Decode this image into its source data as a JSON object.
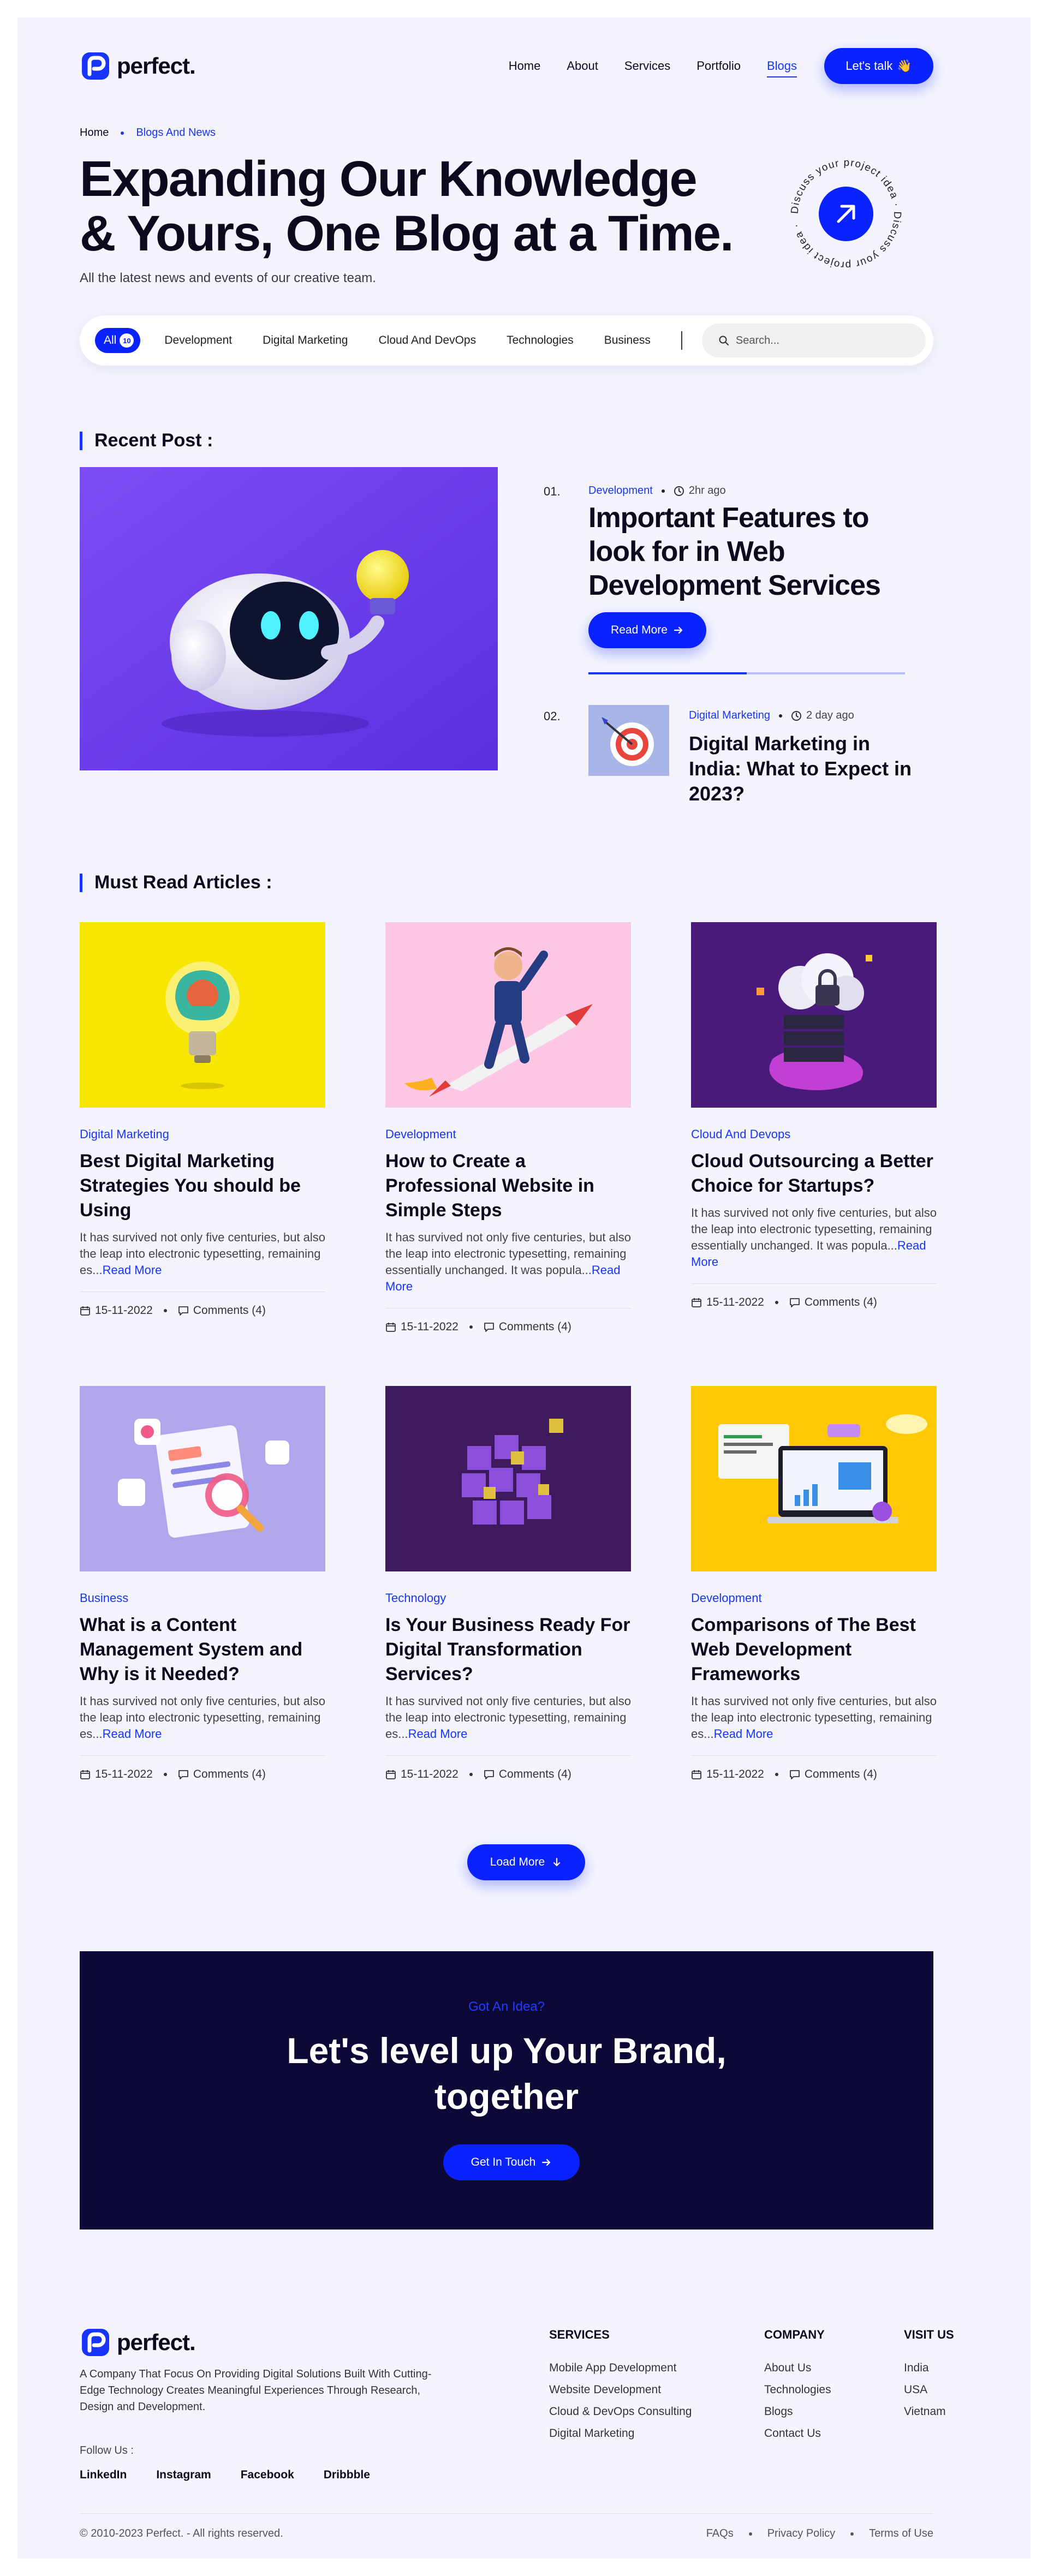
{
  "header": {
    "logo_text": "perfect.",
    "nav": [
      "Home",
      "About",
      "Services",
      "Portfolio",
      "Blogs"
    ],
    "active_nav": "Blogs",
    "cta_label": "Let's talk",
    "cta_emoji": "👋"
  },
  "breadcrumb": {
    "home": "Home",
    "current": "Blogs And News"
  },
  "hero": {
    "title": "Expanding Our Knowledge & Yours, One Blog at a Time.",
    "subtitle": "All the latest news and events of our creative team.",
    "badge_text": "Discuss your project idea · Discuss your project idea ·"
  },
  "filter": {
    "all_label": "All",
    "all_count": "10",
    "categories": [
      "Development",
      "Digital Marketing",
      "Cloud And DevOps",
      "Technologies",
      "Business"
    ],
    "search_placeholder": "Search..."
  },
  "recent": {
    "section_title": "Recent Post :",
    "post1": {
      "num": "01.",
      "category": "Development",
      "time": "2hr ago",
      "title": "Important Features to look for in Web Development Services",
      "button": "Read More"
    },
    "progress": 0.5,
    "post2": {
      "num": "02.",
      "category": "Digital Marketing",
      "time": "2 day ago",
      "title": "Digital Marketing in India: What to Expect in 2023?"
    }
  },
  "must_read": {
    "section_title": "Must Read Articles :",
    "read_more": "Read More",
    "cards": [
      {
        "category": "Digital Marketing",
        "title": "Best Digital Marketing Strategies You should be Using",
        "desc": "It has survived not only five centuries, but also the leap into electronic typesetting, remaining es...",
        "date": "15-11-2022",
        "comments": "Comments (4)"
      },
      {
        "category": "Development",
        "title": "How to Create a Professional Website in Simple Steps",
        "desc": "It has survived not only five centuries, but also the leap into electronic typesetting, remaining essentially unchanged. It was popula...",
        "date": "15-11-2022",
        "comments": "Comments (4)"
      },
      {
        "category": "Cloud And Devops",
        "title": "Cloud Outsourcing a Better Choice for Startups?",
        "desc": "It has survived not only five centuries, but also the leap into electronic typesetting, remaining essentially unchanged. It was popula...",
        "date": "15-11-2022",
        "comments": "Comments (4)"
      },
      {
        "category": "Business",
        "title": "What is a Content Management System and Why is it Needed?",
        "desc": "It has survived not only five centuries, but also the leap into electronic typesetting, remaining es...",
        "date": "15-11-2022",
        "comments": "Comments (4)"
      },
      {
        "category": "Technology",
        "title": "Is Your Business Ready For Digital Transformation Services?",
        "desc": "It has survived not only five centuries, but also the leap into electronic typesetting, remaining es...",
        "date": "15-11-2022",
        "comments": "Comments (4)"
      },
      {
        "category": "Development",
        "title": "Comparisons of The Best Web Development Frameworks",
        "desc": "It has survived not only five centuries, but also the leap into electronic typesetting, remaining es...",
        "date": "15-11-2022",
        "comments": "Comments (4)"
      }
    ],
    "load_more": "Load More"
  },
  "cta": {
    "eyebrow": "Got An Idea?",
    "title_line1": "Let's level up Your Brand,",
    "title_line2": "together",
    "button": "Get In Touch"
  },
  "footer": {
    "logo_text": "perfect.",
    "description": "A Company That Focus On Providing Digital Solutions Built With Cutting-Edge Technology Creates Meaningful Experiences Through Research, Design and Development.",
    "follow_label": "Follow Us :",
    "social": [
      "LinkedIn",
      "Instagram",
      "Facebook",
      "Dribbble"
    ],
    "services_title": "SERVICES",
    "services": [
      "Mobile App Development",
      "Website Development",
      "Cloud & DevOps Consulting",
      "Digital Marketing"
    ],
    "company_title": "COMPANY",
    "company": [
      "About Us",
      "Technologies",
      "Blogs",
      "Contact Us"
    ],
    "visit_title": "VISIT US",
    "visit": [
      "India",
      "USA",
      "Vietnam"
    ],
    "copyright": "© 2010-2023 Perfect. - All rights reserved.",
    "legal": [
      "FAQs",
      "Privacy Policy",
      "Terms of Use"
    ]
  },
  "colors": {
    "accent": "#0a22ff",
    "background": "#f3f4fd",
    "cta_bg": "#0d0937"
  }
}
